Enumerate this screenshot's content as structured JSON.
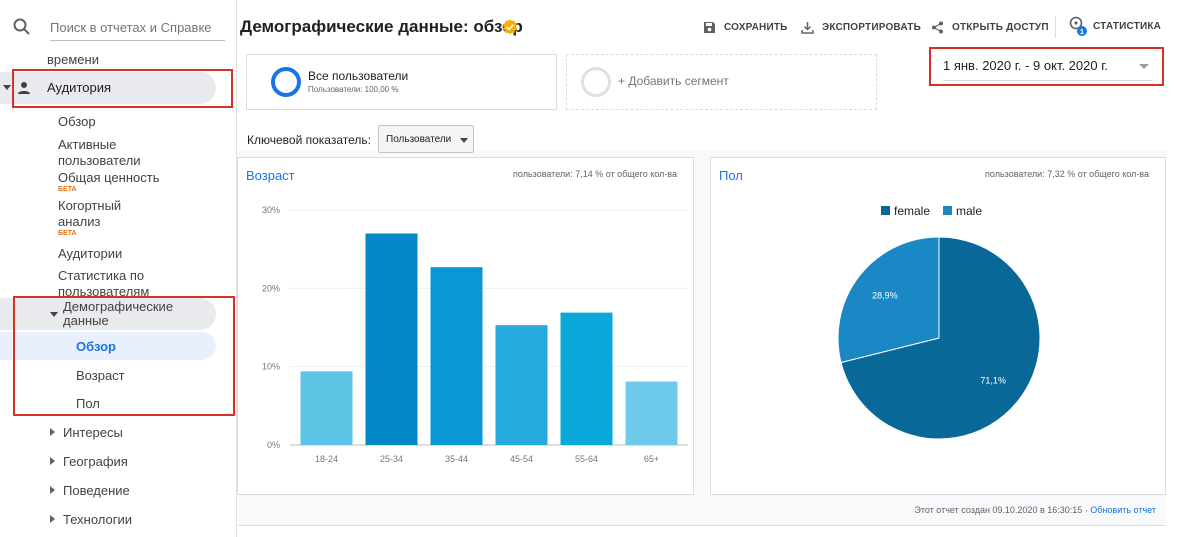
{
  "search": {
    "placeholder": "Поиск в отчетах и Справке"
  },
  "sidebar": {
    "partial_item": "времени",
    "audience_label": "Аудитория",
    "sub_items": [
      {
        "label": "Обзор"
      },
      {
        "label": "Активные пользователи"
      },
      {
        "label": "Общая ценность",
        "badge": "БЕТА"
      },
      {
        "label": "Когортный анализ",
        "badge": "БЕТА"
      },
      {
        "label": "Аудитории"
      },
      {
        "label": "Статистика по пользователям"
      }
    ],
    "demographics_label": "Демографические данные",
    "demographics_children": [
      "Обзор",
      "Возраст",
      "Пол"
    ],
    "collapsed": [
      "Интересы",
      "География",
      "Поведение",
      "Технологии"
    ]
  },
  "header": {
    "title": "Демографические данные: обзор",
    "toolbar": {
      "save": "СОХРАНИТЬ",
      "export": "ЭКСПОРТИРОВАТЬ",
      "share": "ОТКРЫТЬ ДОСТУП",
      "insights": "СТАТИСТИКА",
      "insights_count": "1"
    }
  },
  "segments": {
    "active_title": "Все пользователи",
    "active_sub": "Пользователи: 100,00 %",
    "add_label": "+ Добавить сегмент"
  },
  "date_range": "1 янв. 2020 г. - 9 окт. 2020 г.",
  "metric": {
    "label": "Ключевой показатель:",
    "value": "Пользователи"
  },
  "colors": {
    "accent": "#1a73e8",
    "highlight": "#d93025",
    "female": "#0a6899",
    "male": "#1b88c6"
  },
  "panels": {
    "age": {
      "title": "Возраст",
      "note": "пользователи: 7,14 % от общего кол-ва"
    },
    "gender": {
      "title": "Пол",
      "note": "пользователи: 7,32 % от общего кол-ва"
    }
  },
  "chart_data": [
    {
      "type": "bar",
      "title": "Возраст",
      "categories": [
        "18-24",
        "25-34",
        "35-44",
        "45-54",
        "55-64",
        "65+"
      ],
      "values": [
        9.4,
        27.0,
        22.7,
        15.3,
        16.9,
        8.1
      ],
      "colors": [
        "#5ec4e6",
        "#0288c6",
        "#0a97d4",
        "#26aade",
        "#0aa8d8",
        "#6ccbea"
      ],
      "ylim": [
        0,
        30
      ],
      "yticks": [
        "0%",
        "10%",
        "20%",
        "30%"
      ],
      "grid": true
    },
    {
      "type": "pie",
      "title": "Пол",
      "labels": [
        "female",
        "male"
      ],
      "values": [
        71.1,
        28.9
      ],
      "value_labels": [
        "71,1%",
        "28,9%"
      ],
      "legend": "top"
    }
  ],
  "footer": {
    "created": "Этот отчет создан 09.10.2020 в 16:30:15 ·",
    "refresh": "Обновить отчет"
  }
}
